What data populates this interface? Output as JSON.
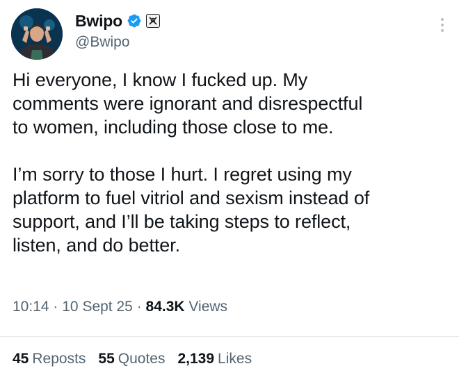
{
  "tweet": {
    "author": {
      "display_name": "Bwipo",
      "handle": "@Bwipo",
      "verified": true,
      "avatar_icon": "profile-photo",
      "affiliation_icon": "team-badge-icon",
      "verified_color": "#1d9bf0"
    },
    "more_icon": "more-vertical-icon",
    "paragraphs": [
      "Hi everyone, I know I fucked up. My\ncomments were ignorant and disrespectful\nto women, including those close to me.",
      "I’m sorry to those I hurt. I regret using my\nplatform to fuel vitriol and sexism instead of\nsupport, and I’ll be taking steps to reflect,\nlisten, and do better."
    ],
    "meta": {
      "time": "10:14",
      "separator": "·",
      "date": "10 Sept 25",
      "views_count": "84.3K",
      "views_label": "Views"
    },
    "stats": [
      {
        "count": "45",
        "label": "Reposts"
      },
      {
        "count": "55",
        "label": "Quotes"
      },
      {
        "count": "2,139",
        "label": "Likes"
      }
    ]
  },
  "colors": {
    "text_primary": "#0f1419",
    "text_secondary": "#536471",
    "divider": "#e6eaed",
    "background": "#ffffff"
  }
}
